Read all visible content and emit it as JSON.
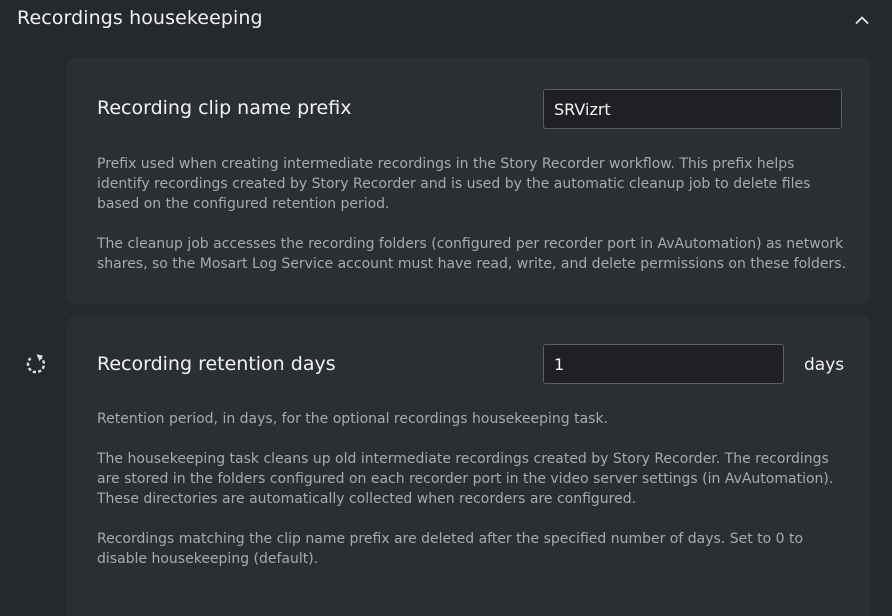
{
  "section": {
    "title": "Recordings housekeeping",
    "toggle_icon": "chevron-up-icon"
  },
  "clip_prefix": {
    "label": "Recording clip name prefix",
    "value": "SRVizrt",
    "description_1": "Prefix used when creating intermediate recordings in the Story Recorder workflow. This prefix helps identify recordings created by Story Recorder and is used by the automatic cleanup job to delete files based on the configured retention period.",
    "description_2": "The cleanup job accesses the recording folders (configured per recorder port in AvAutomation) as network shares, so the Mosart Log Service account must have read, write, and delete permissions on these folders."
  },
  "retention": {
    "label": "Recording retention days",
    "value": "1",
    "unit": "days",
    "reset_icon": "reset-icon",
    "description_1": "Retention period, in days, for the optional recordings housekeeping task.",
    "description_2": "The housekeeping task cleans up old intermediate recordings created by Story Recorder. The recordings are stored in the folders configured on each recorder port in the video server settings (in AvAutomation). These directories are automatically collected when recorders are configured.",
    "description_3": "Recordings matching the clip name prefix are deleted after the specified number of days. Set to 0 to disable housekeeping (default)."
  },
  "colors": {
    "background": "#25282c",
    "card": "#2b2e33",
    "input_bg": "#1e2023",
    "text_primary": "#f2f2f2",
    "text_secondary": "#a6abb1"
  }
}
